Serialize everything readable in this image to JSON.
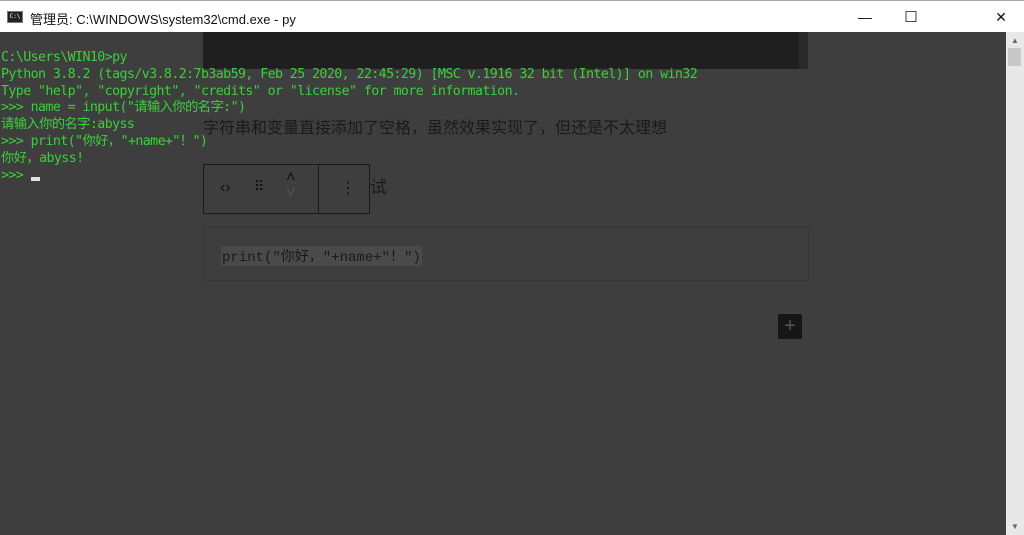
{
  "window": {
    "title": "管理员: C:\\WINDOWS\\system32\\cmd.exe - py",
    "icon": "cmd-icon",
    "icon_text": "C:\\"
  },
  "controls": {
    "minimize": "—",
    "maximize": "☐",
    "close": "✕"
  },
  "console": {
    "lines": [
      "C:\\Users\\WIN10>py",
      "Python 3.8.2 (tags/v3.8.2:7b3ab59, Feb 25 2020, 22:45:29) [MSC v.1916 32 bit (Intel)] on win32",
      "Type \"help\", \"copyright\", \"credits\" or \"license\" for more information.",
      ">>> name = input(\"请输入你的名字:\")",
      "请输入你的名字:abyss",
      ">>> print(\"你好，\"+name+\"！\")",
      "你好，abyss!",
      ">>> "
    ],
    "text_color": "#3ccf3c",
    "bg_color": "#3e3e3e"
  },
  "background_editor": {
    "paragraph": "字符串和变量直接添加了空格，虽然效果实现了，但还是不太理想",
    "heading_fragment": "试",
    "toolbar": {
      "code_icon": "‹›",
      "drag_icon": "⠿",
      "up_icon": "˄",
      "down_icon": "˅",
      "more_icon": "⋮"
    },
    "code": "print(\"你好，\"+name+\"！\")",
    "add_block": "+"
  }
}
